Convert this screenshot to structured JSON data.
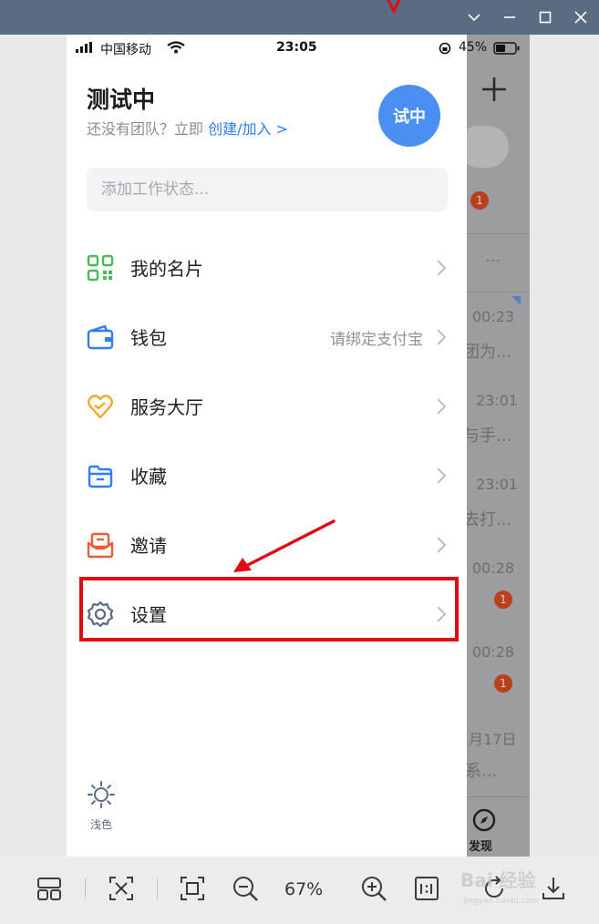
{
  "window": {
    "controls": [
      "chevron-down-icon",
      "minimize-icon",
      "maximize-icon",
      "close-icon"
    ]
  },
  "status_bar": {
    "carrier": "中国移动",
    "time": "23:05",
    "battery": "45%"
  },
  "profile": {
    "name": "测试中",
    "team_prompt": "还没有团队？立即",
    "team_link": "创建/加入 >",
    "avatar_text": "试中"
  },
  "work_status": {
    "placeholder": "添加工作状态..."
  },
  "menu": {
    "items": [
      {
        "label": "我的名片",
        "icon": "qr-card-icon",
        "color": "#4bb85b"
      },
      {
        "label": "钱包",
        "icon": "wallet-icon",
        "color": "#2f7ef5",
        "extra": "请绑定支付宝"
      },
      {
        "label": "服务大厅",
        "icon": "service-hall-icon",
        "color": "#f5a623"
      },
      {
        "label": "收藏",
        "icon": "favorites-folder-icon",
        "color": "#2f7ef5"
      },
      {
        "label": "邀请",
        "icon": "invite-envelope-icon",
        "color": "#ef5a31"
      },
      {
        "label": "设置",
        "icon": "gear-icon",
        "color": "#5a6b80"
      }
    ]
  },
  "theme": {
    "label": "浅色",
    "icon": "sun-icon"
  },
  "background_app": {
    "times": [
      "00:23",
      "23:01",
      "23:01",
      "00:28",
      "00:28",
      "月17日"
    ],
    "snippets": [
      "团为...",
      "与手...",
      "去打...",
      "系..."
    ],
    "badges": [
      "1",
      "1",
      "1"
    ],
    "discover_label": "发现"
  },
  "toolbar": {
    "zoom_level": "67%",
    "buttons": [
      "layout-icon",
      "text-recognition-icon",
      "fit-screen-icon",
      "zoom-out-icon",
      "zoom-in-icon",
      "actual-size-icon",
      "rotate-icon",
      "download-icon"
    ]
  },
  "annotation": {
    "highlight_color": "#e00b12"
  },
  "watermark": {
    "text": "Bai 经验",
    "sub": "jingyan.baidu.com"
  }
}
